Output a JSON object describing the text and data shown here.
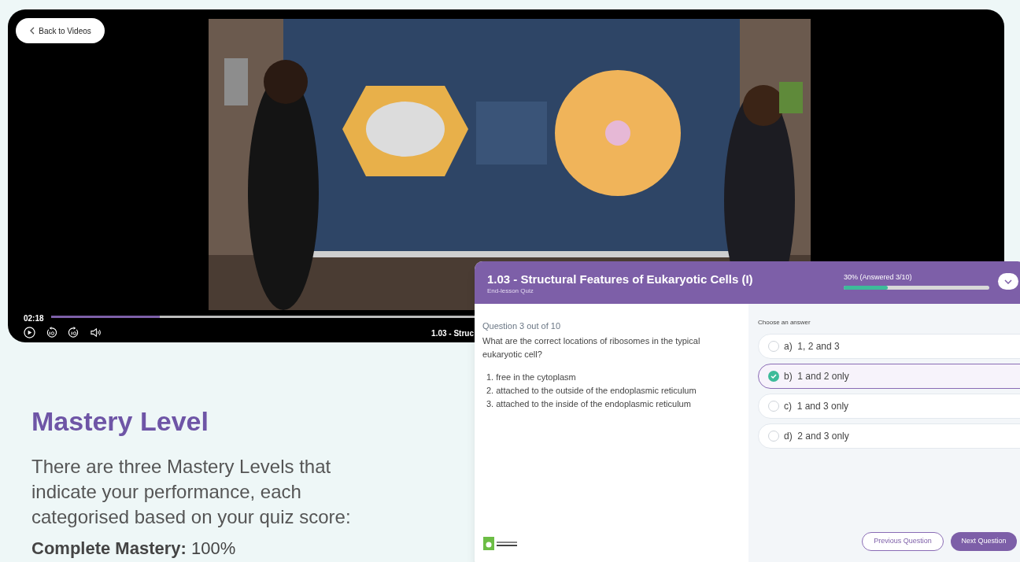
{
  "player": {
    "back_button": "Back to Videos",
    "time": "02:18",
    "progress": {
      "level": 0.256
    },
    "caption": "1.03 - Struc"
  },
  "mastery": {
    "heading": "Mastery Level",
    "text": "There are three Mastery Levels that indicate your performance, each categorised based on your quiz score:",
    "first_level": "**Complete Mastery:** 100%"
  },
  "quiz": {
    "title": "1.03 - Structural Features of Eukaryotic Cells (I)",
    "subtitle": "End-lesson Quiz",
    "progress_label": "30% (Answered 3/10)",
    "progress": {
      "level": 0.3
    },
    "question_counter": "Question 3 out of 10",
    "question": "What are the correct locations of ribosomes in the typical eukaryotic cell?",
    "statements": [
      "1. free in the cytoplasm",
      "2. attached to the outside of the endoplasmic reticulum",
      "3. attached to the inside of the endoplasmic reticulum"
    ],
    "answers_label": "Choose an answer",
    "answers": [
      {
        "letter": "a)",
        "text": "1, 2 and 3",
        "selected": false
      },
      {
        "letter": "b)",
        "text": "1 and 2 only",
        "selected": true
      },
      {
        "letter": "c)",
        "text": "1 and 3 only",
        "selected": false
      },
      {
        "letter": "d)",
        "text": "2 and 3 only",
        "selected": false
      }
    ],
    "buttons": [
      "Previous Question",
      "Next Question"
    ]
  }
}
